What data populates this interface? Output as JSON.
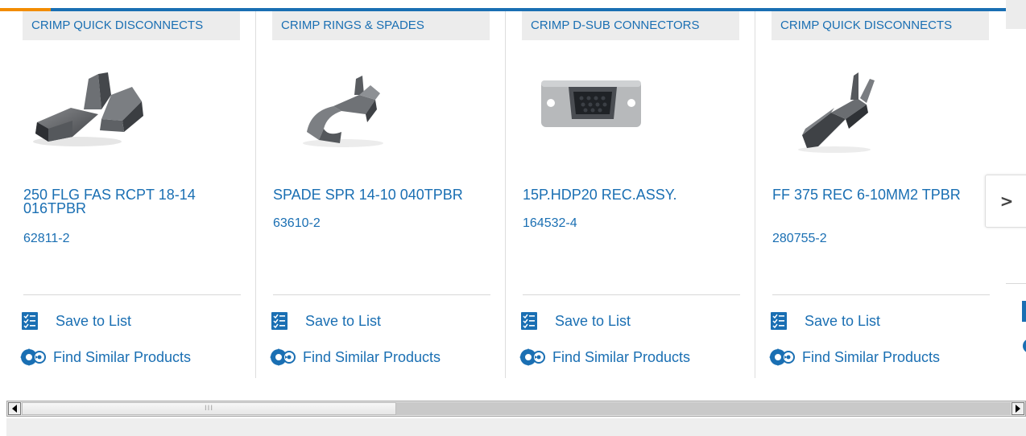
{
  "cards": [
    {
      "category": "CRIMP QUICK DISCONNECTS",
      "title": "250 FLG FAS RCPT 18-14 016TPBR",
      "part_number": "62811-2",
      "image": "flag-receptacle-terminal"
    },
    {
      "category": "CRIMP RINGS & SPADES",
      "title": "SPADE SPR 14-10 040TPBR",
      "part_number": "63610-2",
      "image": "spade-terminal"
    },
    {
      "category": "CRIMP D-SUB CONNECTORS",
      "title": "15P.HDP20 REC.ASSY.",
      "part_number": "164532-4",
      "image": "d-sub-receptacle"
    },
    {
      "category": "CRIMP QUICK DISCONNECTS",
      "title": "FF 375 REC 6-10MM2 TPBR",
      "part_number": "280755-2",
      "image": "fast-on-receptacle"
    }
  ],
  "actions": {
    "save_label": "Save to List",
    "find_label": "Find Similar Products"
  },
  "icons": {
    "save": "checklist-icon",
    "find": "gears-icon",
    "next": "chevron-right-icon",
    "scroll_left": "arrow-left-icon",
    "scroll_right": "arrow-right-icon"
  },
  "next_button": {
    "label": ">"
  },
  "scrollbar": {
    "grip": "III"
  },
  "colors": {
    "link": "#1a6fb3",
    "accent_orange": "#f28c00",
    "category_bg": "#ececec"
  }
}
